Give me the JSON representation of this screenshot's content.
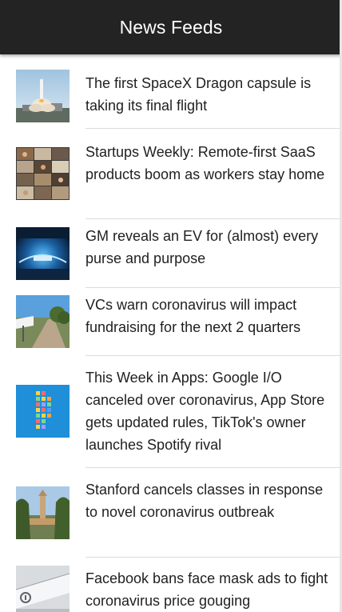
{
  "app": {
    "title": "News Feeds"
  },
  "feed": {
    "items": [
      {
        "headline": "The first SpaceX Dragon capsule is taking its final flight",
        "thumbnail": "rocket-launch-image"
      },
      {
        "headline": "Startups Weekly: Remote-first SaaS products boom as workers stay home",
        "thumbnail": "video-call-grid-image"
      },
      {
        "headline": "GM reveals an EV for (almost) every purse and purpose",
        "thumbnail": "ev-stage-reveal-image"
      },
      {
        "headline": "VCs warn coronavirus will impact fundraising for the next 2 quarters",
        "thumbnail": "funding-road-sign-image"
      },
      {
        "headline": "This Week in Apps: Google I/O canceled over coronavirus, App Store gets updated rules, TikTok's owner launches Spotify rival",
        "thumbnail": "colorful-app-blocks-image"
      },
      {
        "headline": "Stanford cancels classes in response to novel coronavirus outbreak",
        "thumbnail": "stanford-campus-tower-image"
      },
      {
        "headline": "Facebook bans face mask ads to fight coronavirus price gouging",
        "thumbnail": "facebook-sign-image"
      }
    ]
  },
  "colors": {
    "appbar": "#232323",
    "appbar_text": "#ffffff",
    "headline_text": "#1f1f1f",
    "divider": "#dcdcdc"
  }
}
